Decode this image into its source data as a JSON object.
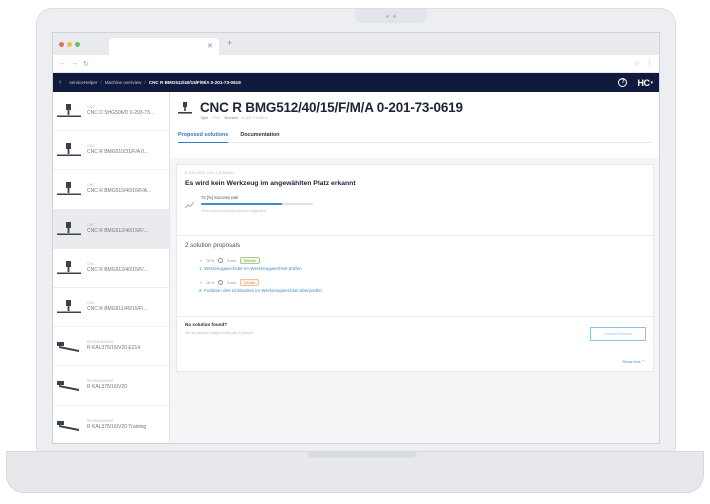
{
  "app": {
    "breadcrumbs": [
      "serviceHelper",
      "Machine overview",
      "CNC R BMG512/40/15/F/M/A 0-201-73-0619"
    ],
    "help_icon": "?",
    "brand": "HC",
    "colors": {
      "header_bg": "#0f1a3c",
      "accent": "#2e7ec0",
      "success_green": "#a9cf8c",
      "warning_orange": "#efc29a"
    }
  },
  "sidebar": {
    "items": [
      {
        "kind": "CNC",
        "name": "CNC D SHG506/D 0-293-73...",
        "selected": false,
        "icon": "spindle-icon"
      },
      {
        "kind": "CNC",
        "name": "CNC R BMG510/31/F/A 0...",
        "selected": false,
        "icon": "spindle-icon"
      },
      {
        "kind": "CNC",
        "name": "CNC R BMG510/40/16/F/A...",
        "selected": false,
        "icon": "spindle-icon"
      },
      {
        "kind": "CNC",
        "name": "CNC R BMG512/40/15/F/...",
        "selected": true,
        "icon": "spindle-icon"
      },
      {
        "kind": "CNC",
        "name": "CNC R BMG512/40/15/F/...",
        "selected": false,
        "icon": "spindle-icon"
      },
      {
        "kind": "CNC",
        "name": "CNC R BMG611/40/15/F/...",
        "selected": false,
        "icon": "spindle-icon"
      },
      {
        "kind": "EDGEBANDING",
        "name": "R KAL375/16/V20 E214",
        "selected": false,
        "icon": "edgebander-icon"
      },
      {
        "kind": "EDGEBANDING",
        "name": "R KAL375/16/V20",
        "selected": false,
        "icon": "edgebander-icon"
      },
      {
        "kind": "EDGEBANDING",
        "name": "R KAL375/16/V20 Training",
        "selected": false,
        "icon": "edgebander-icon"
      }
    ]
  },
  "machine": {
    "title": "CNC R BMG512/40/15/F/M/A 0-201-73-0619",
    "type_label": "Type",
    "type_value": "CNC",
    "number_label": "Number",
    "number_value": "0-201-73-0619"
  },
  "tabs": [
    "Proposed solutions",
    "Documentation"
  ],
  "error": {
    "code": "E 1001 0001 1001 1 20180410",
    "title": "Es wird kein Werkzeug im angewählten Platz erkannt",
    "success_label": "72 [%] Success rate",
    "success_rate": 0.72,
    "success_note": "When performing the solution suggestion"
  },
  "proposals": {
    "title": "2 solution proposals",
    "items": [
      {
        "rate": "76 %",
        "time": "5 min",
        "badge": "Remote",
        "badge_color": "green",
        "link": "1. Werkzeugwechsler im Werkzeugwechsel prüfen"
      },
      {
        "rate": "18 %",
        "time": "5 min",
        "badge": "On site",
        "badge_color": "orange",
        "link": "2. Funktion des Lichtladers im Werkzeugwechsel überprüfen"
      }
    ]
  },
  "no_solution": {
    "title": "No solution found?",
    "subtitle": "We are always ready to help you in person.",
    "contact_button": "Contact Service",
    "show_less": "Show less ⌃"
  }
}
